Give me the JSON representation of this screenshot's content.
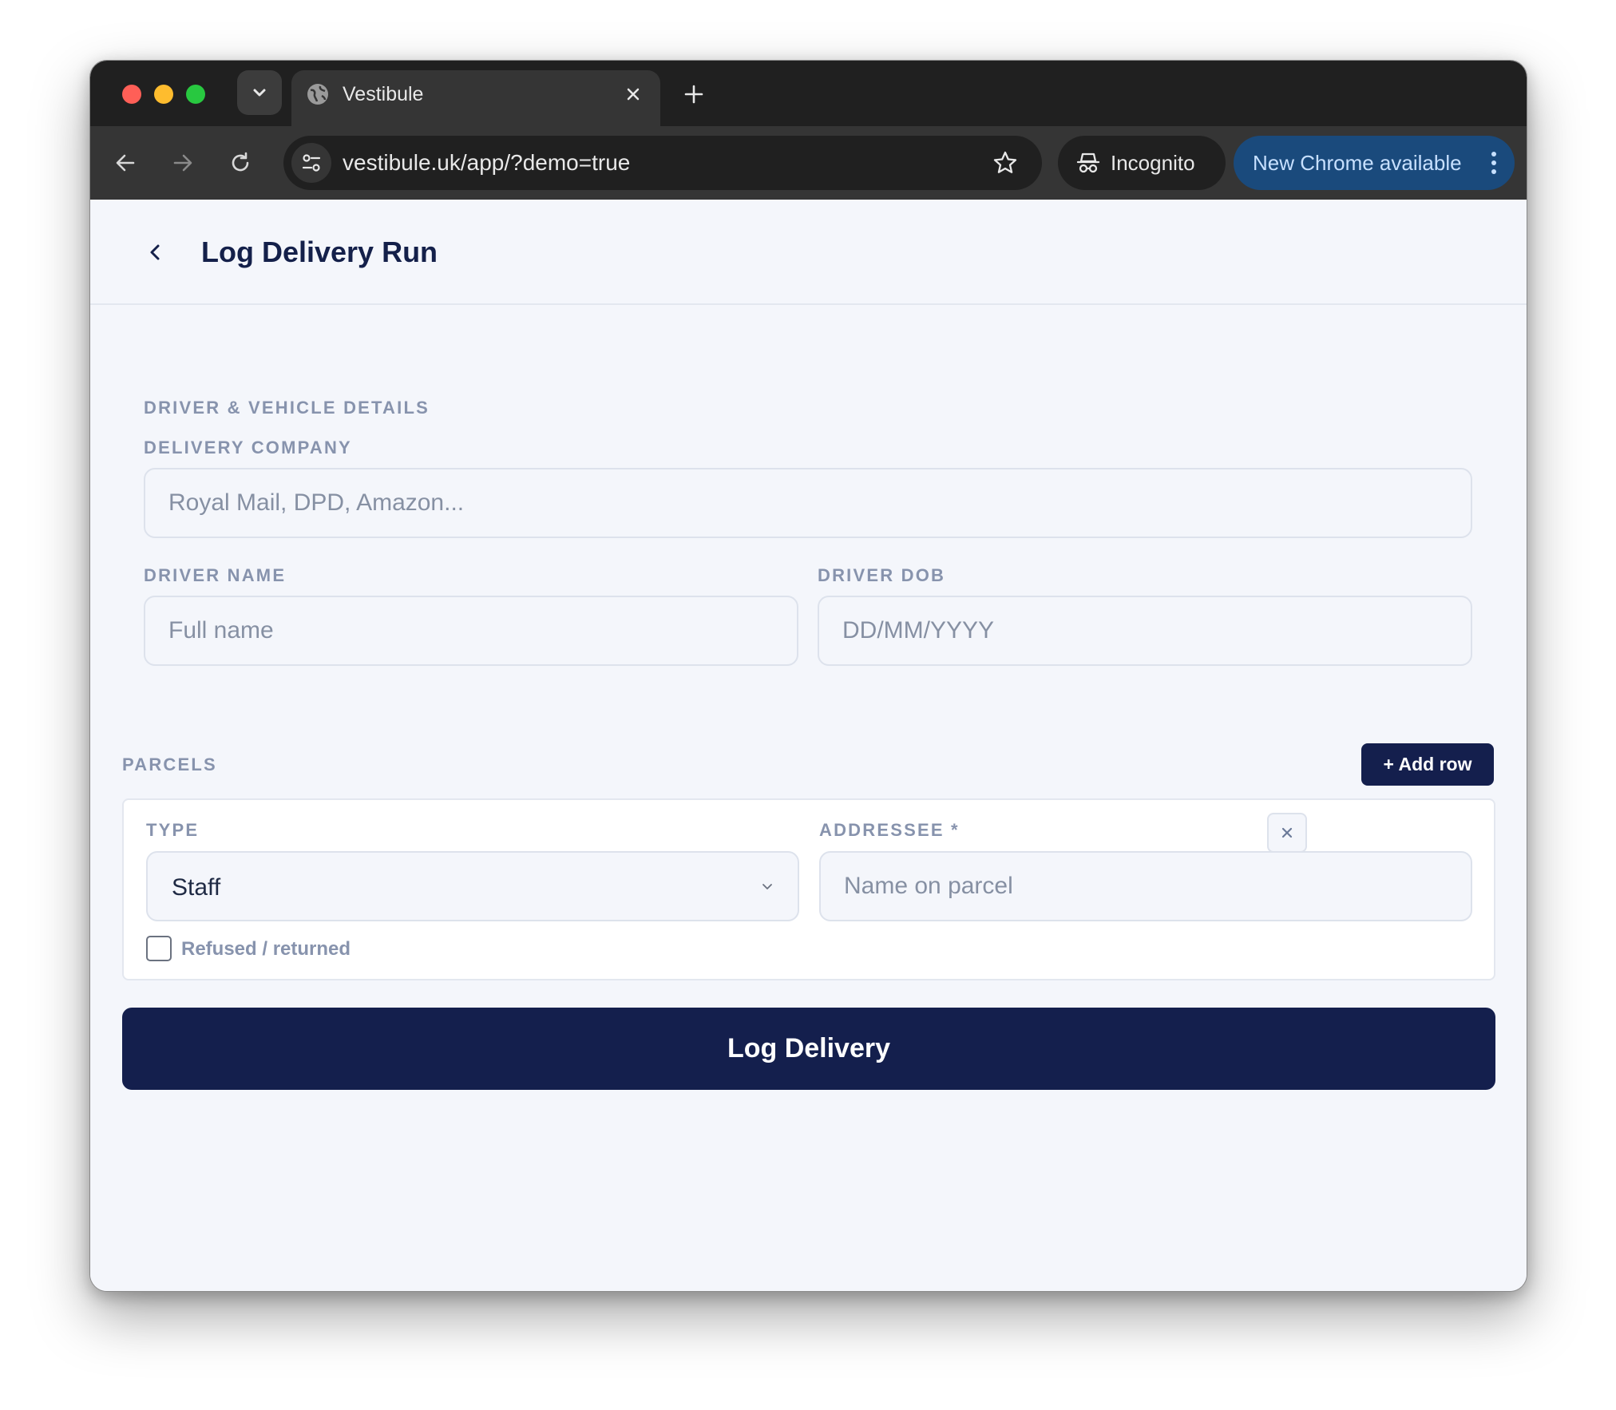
{
  "browser": {
    "tab_title": "Vestibule",
    "url": "vestibule.uk/app/?demo=true",
    "incognito_label": "Incognito",
    "update_label": "New Chrome available"
  },
  "app": {
    "page_title": "Log Delivery Run",
    "driver_section": {
      "heading": "DRIVER & VEHICLE DETAILS",
      "company_label": "DELIVERY COMPANY",
      "company_placeholder": "Royal Mail, DPD, Amazon...",
      "driver_name_label": "DRIVER NAME",
      "driver_name_placeholder": "Full name",
      "driver_dob_label": "DRIVER DOB",
      "driver_dob_placeholder": "DD/MM/YYYY"
    },
    "parcels_section": {
      "heading": "PARCELS",
      "add_row_label": "+ Add row",
      "rows": [
        {
          "type_label": "TYPE",
          "type_value": "Staff",
          "addressee_label": "ADDRESSEE *",
          "addressee_placeholder": "Name on parcel",
          "refused_label": "Refused / returned",
          "refused_checked": false
        }
      ]
    },
    "submit_label": "Log Delivery"
  },
  "colors": {
    "primary": "#141f4d",
    "label": "#8793ad",
    "background": "#f4f6fb",
    "chrome_update": "#1a4a7c"
  }
}
